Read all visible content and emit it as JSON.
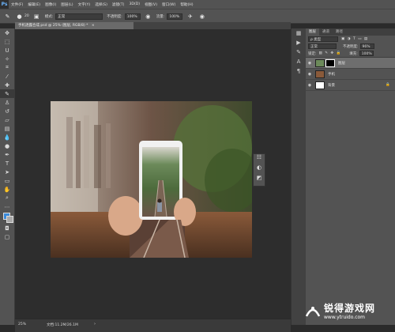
{
  "app": {
    "logo": "Ps"
  },
  "menu": [
    "文件(F)",
    "编辑(E)",
    "图像(I)",
    "图层(L)",
    "文字(Y)",
    "选择(S)",
    "滤镜(T)",
    "3D(D)",
    "视图(V)",
    "窗口(W)",
    "帮助(H)"
  ],
  "options": {
    "brush_size": "20",
    "mode_label": "模式:",
    "mode_value": "正常",
    "opacity_label": "不透明度:",
    "opacity_value": "100%",
    "flow_label": "流量:",
    "flow_value": "100%"
  },
  "document": {
    "tab_title": "手机透露合成.psd @ 25% (图层, RGB/8) *",
    "close_glyph": "×"
  },
  "status": {
    "zoom": "25%",
    "doc_info": "文档:11.2M/26.1M"
  },
  "panel": {
    "tabs": [
      "图层",
      "通道",
      "路径"
    ],
    "filter_label": "ρ 类型",
    "blend_mode": "正常",
    "opacity_label": "不透明度:",
    "opacity_value": "96%",
    "lock_label": "锁定:",
    "fill_label": "填充:",
    "fill_value": "100%"
  },
  "layers": [
    {
      "name": "图层",
      "selected": true
    },
    {
      "name": "手机",
      "selected": false
    },
    {
      "name": "背景",
      "selected": false
    }
  ],
  "watermark": {
    "text": "锐得游戏网",
    "url": "www.ytruido.com"
  },
  "colors": {
    "accent": "#6cb6ff",
    "panel_bg": "#535353",
    "canvas_bg": "#2d2d2d"
  }
}
